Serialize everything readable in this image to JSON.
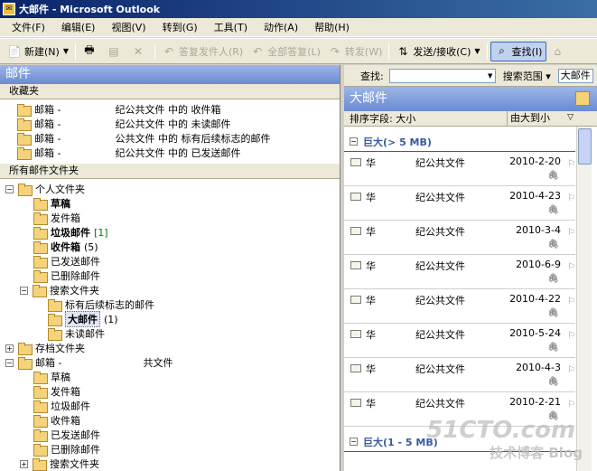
{
  "window": {
    "title": "大邮件 - Microsoft Outlook"
  },
  "menu": [
    "文件(F)",
    "编辑(E)",
    "视图(V)",
    "转到(G)",
    "工具(T)",
    "动作(A)",
    "帮助(H)"
  ],
  "toolbar": {
    "new": "新建(N)",
    "reply": "答复发件人(R)",
    "reply_all": "全部答复(L)",
    "forward": "转发(W)",
    "send_receive": "发送/接收(C)",
    "find": "查找(I)"
  },
  "left": {
    "header": "邮件",
    "favorites_label": "收藏夹",
    "favorites": [
      {
        "prefix": "邮箱 -",
        "suffix": "纪公共文件 中的 收件箱"
      },
      {
        "prefix": "邮箱 -",
        "suffix": "纪公共文件 中的 未读邮件"
      },
      {
        "prefix": "邮箱 -",
        "suffix": "公共文件 中的 标有后续标志的邮件"
      },
      {
        "prefix": "邮箱 -",
        "suffix": "纪公共文件 中的 已发送邮件"
      }
    ],
    "all_folders_label": "所有邮件文件夹",
    "personal_root": "个人文件夹",
    "personal": {
      "drafts": "草稿",
      "outbox": "发件箱",
      "junk": "垃圾邮件",
      "junk_count": "[1]",
      "inbox": "收件箱",
      "inbox_count": "(5)",
      "sent": "已发送邮件",
      "deleted": "已删除邮件",
      "search_root": "搜索文件夹",
      "search_flagged": "标有后续标志的邮件",
      "search_large": "大邮件",
      "search_large_count": "(1)",
      "search_unread": "未读邮件"
    },
    "archive_root": "存档文件夹",
    "mailbox_root_prefix": "邮箱 -",
    "mailbox_root_suffix": "共文件",
    "mailbox": {
      "drafts": "草稿",
      "outbox": "发件箱",
      "junk": "垃圾邮件",
      "inbox": "收件箱",
      "sent": "已发送邮件",
      "deleted": "已删除邮件",
      "search_root": "搜索文件夹"
    }
  },
  "right": {
    "find_label": "查找:",
    "scope_label": "搜索范围",
    "scope_value": "大邮件",
    "header": "大邮件",
    "sort_label": "排序字段: 大小",
    "sort_order": "由大到小",
    "group1": "巨大(> 5 MB)",
    "group2": "巨大(1 - 5 MB)",
    "messages": [
      {
        "sender": "华",
        "subject_tail": "纪公共文件",
        "date": "2010-2-20"
      },
      {
        "sender": "华",
        "subject_tail": "纪公共文件",
        "date": "2010-4-23"
      },
      {
        "sender": "华",
        "subject_tail": "纪公共文件",
        "date": "2010-3-4"
      },
      {
        "sender": "华",
        "subject_tail": "纪公共文件",
        "date": "2010-6-9"
      },
      {
        "sender": "华",
        "subject_tail": "纪公共文件",
        "date": "2010-4-22"
      },
      {
        "sender": "华",
        "subject_tail": "纪公共文件",
        "date": "2010-5-24"
      },
      {
        "sender": "华",
        "subject_tail": "纪公共文件",
        "date": "2010-4-3"
      },
      {
        "sender": "华",
        "subject_tail": "纪公共文件",
        "date": "2010-2-21"
      }
    ]
  },
  "watermark": {
    "line1": "51CTO.com",
    "line2": "技术博客 Blog"
  }
}
